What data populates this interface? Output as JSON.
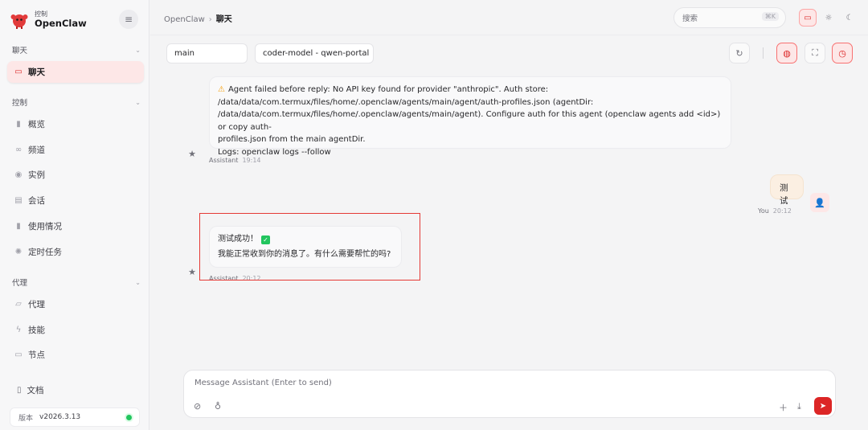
{
  "brand": {
    "sub": "控制",
    "name": "OpenClaw",
    "collapse_icon": "menu-icon"
  },
  "sidebar": {
    "sections": [
      {
        "label": "聊天"
      },
      {
        "label": "控制"
      },
      {
        "label": "代理"
      }
    ],
    "items": [
      {
        "label": "聊天",
        "icon": "chat-icon"
      },
      {
        "label": "概览",
        "icon": "bar-chart-icon"
      },
      {
        "label": "频道",
        "icon": "link-icon"
      },
      {
        "label": "实例",
        "icon": "broadcast-icon"
      },
      {
        "label": "会话",
        "icon": "document-icon"
      },
      {
        "label": "使用情况",
        "icon": "usage-chart-icon"
      },
      {
        "label": "定时任务",
        "icon": "cron-icon"
      },
      {
        "label": "代理",
        "icon": "folder-icon"
      },
      {
        "label": "技能",
        "icon": "bolt-icon"
      },
      {
        "label": "节点",
        "icon": "monitor-icon"
      }
    ],
    "docs": {
      "label": "文档",
      "icon": "book-icon"
    },
    "version": {
      "label": "版本",
      "value": "v2026.3.13",
      "status_color": "#22c55e"
    }
  },
  "topbar": {
    "breadcrumb_root": "OpenClaw",
    "breadcrumb_sep": "›",
    "breadcrumb_current": "聊天",
    "search_placeholder": "搜索",
    "search_kbd": "⌘K"
  },
  "chat_header": {
    "session": "main",
    "model": "coder-model - qwen-portal"
  },
  "messages": [
    {
      "role": "assistant",
      "lines": [
        "Agent failed before reply: No API key found for provider \"anthropic\". Auth store:",
        "/data/data/com.termux/files/home/.openclaw/agents/main/agent/auth-profiles.json (agentDir:",
        "/data/data/com.termux/files/home/.openclaw/agents/main/agent). Configure auth for this agent (openclaw agents add <id>) or copy auth-",
        "profiles.json from the main agentDir.",
        "Logs: openclaw logs --follow"
      ],
      "sender": "Assistant",
      "time": "19:14"
    },
    {
      "role": "user",
      "text": "测试",
      "sender": "You",
      "time": "20:12"
    },
    {
      "role": "assistant",
      "line1": "测试成功！",
      "line2": "我能正常收到你的消息了。有什么需要帮忙的吗?",
      "sender": "Assistant",
      "time": "20:12"
    }
  ],
  "composer": {
    "placeholder": "Message Assistant (Enter to send)"
  },
  "colors": {
    "accent": "#dc2626",
    "accent_soft": "#fde7e7",
    "user_bubble": "#fbefe2",
    "highlight": "#e53935"
  }
}
